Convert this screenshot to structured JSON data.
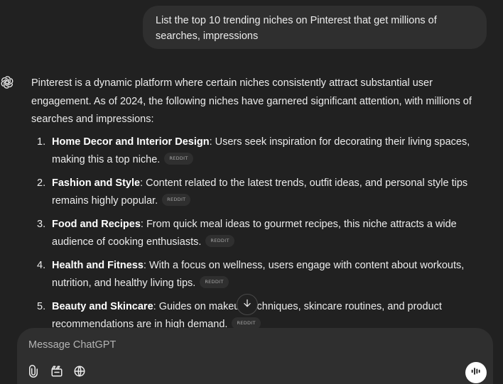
{
  "user_message": {
    "line1": "List the top 10 trending niches on Pinterest that get millions of",
    "line2": "searches, impressions"
  },
  "assistant": {
    "avatar_icon": "openai-logo-icon",
    "intro": "Pinterest is a dynamic platform where certain niches consistently attract substantial user engagement. As of 2024, the following niches have garnered significant attention, with millions of searches and impressions:",
    "items": [
      {
        "number": "1.",
        "title": "Home Decor and Interior Design",
        "text": ": Users seek inspiration for decorating their living spaces, making this a top niche.",
        "source": "REDDIT"
      },
      {
        "number": "2.",
        "title": "Fashion and Style",
        "text": ": Content related to the latest trends, outfit ideas, and personal style tips remains highly popular.",
        "source": "REDDIT"
      },
      {
        "number": "3.",
        "title": "Food and Recipes",
        "text": ": From quick meal ideas to gourmet recipes, this niche attracts a wide audience of cooking enthusiasts.",
        "source": "REDDIT"
      },
      {
        "number": "4.",
        "title": "Health and Fitness",
        "text": ": With a focus on wellness, users engage with content about workouts, nutrition, and healthy living tips.",
        "source": "REDDIT"
      },
      {
        "number": "5.",
        "title": "Beauty and Skincare",
        "text": ": Guides on makeup techniques, skincare routines, and product recommendations are in high demand.",
        "source": "REDDIT"
      }
    ]
  },
  "scroll_button": {
    "icon": "arrow-down-icon"
  },
  "composer": {
    "placeholder": "Message ChatGPT",
    "attach_icon": "paperclip-icon",
    "tools_icon": "toolbox-icon",
    "search_icon": "globe-icon",
    "voice_icon": "voice-waveform-icon"
  },
  "colors": {
    "background": "#212121",
    "bubble": "#2f2f2f",
    "text": "#ececec",
    "chip_text": "#a8a8a8"
  }
}
